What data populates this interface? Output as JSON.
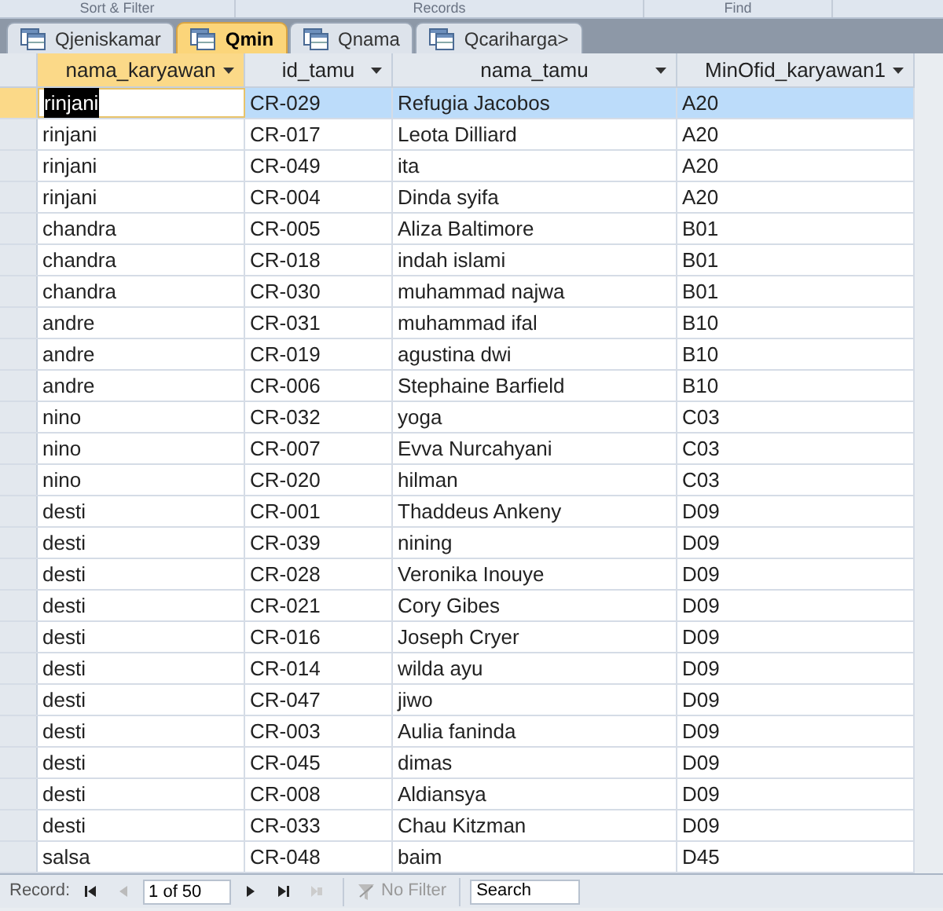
{
  "ribbon_groups": [
    "Sort & Filter",
    "Records",
    "Find"
  ],
  "tabs": [
    {
      "label": "Qjeniskamar",
      "selected": false
    },
    {
      "label": "Qmin",
      "selected": true
    },
    {
      "label": "Qnama",
      "selected": false
    },
    {
      "label": "Qcariharga>",
      "selected": false
    }
  ],
  "table": {
    "columns": [
      "nama_karyawan",
      "id_tamu",
      "nama_tamu",
      "MinOfid_karyawan1"
    ],
    "rows": [
      {
        "cells": [
          "rinjani",
          "CR-029",
          "Refugia Jacobos",
          "A20"
        ],
        "selected": true
      },
      {
        "cells": [
          "rinjani",
          "CR-017",
          "Leota Dilliard",
          "A20"
        ],
        "selected": false
      },
      {
        "cells": [
          "rinjani",
          "CR-049",
          "ita",
          "A20"
        ],
        "selected": false
      },
      {
        "cells": [
          "rinjani",
          "CR-004",
          "Dinda syifa",
          "A20"
        ],
        "selected": false
      },
      {
        "cells": [
          "chandra",
          "CR-005",
          "Aliza Baltimore",
          "B01"
        ],
        "selected": false
      },
      {
        "cells": [
          "chandra",
          "CR-018",
          "indah islami",
          "B01"
        ],
        "selected": false
      },
      {
        "cells": [
          "chandra",
          "CR-030",
          "muhammad najwa",
          "B01"
        ],
        "selected": false
      },
      {
        "cells": [
          "andre",
          "CR-031",
          "muhammad ifal",
          "B10"
        ],
        "selected": false
      },
      {
        "cells": [
          "andre",
          "CR-019",
          "agustina dwi",
          "B10"
        ],
        "selected": false
      },
      {
        "cells": [
          "andre",
          "CR-006",
          "Stephaine Barfield",
          "B10"
        ],
        "selected": false
      },
      {
        "cells": [
          "nino",
          "CR-032",
          "yoga",
          "C03"
        ],
        "selected": false
      },
      {
        "cells": [
          "nino",
          "CR-007",
          "Evva Nurcahyani",
          "C03"
        ],
        "selected": false
      },
      {
        "cells": [
          "nino",
          "CR-020",
          "hilman",
          "C03"
        ],
        "selected": false
      },
      {
        "cells": [
          "desti",
          "CR-001",
          "Thaddeus Ankeny",
          "D09"
        ],
        "selected": false
      },
      {
        "cells": [
          "desti",
          "CR-039",
          "nining",
          "D09"
        ],
        "selected": false
      },
      {
        "cells": [
          "desti",
          "CR-028",
          "Veronika Inouye",
          "D09"
        ],
        "selected": false
      },
      {
        "cells": [
          "desti",
          "CR-021",
          "Cory Gibes",
          "D09"
        ],
        "selected": false
      },
      {
        "cells": [
          "desti",
          "CR-016",
          "Joseph Cryer",
          "D09"
        ],
        "selected": false
      },
      {
        "cells": [
          "desti",
          "CR-014",
          "wilda ayu",
          "D09"
        ],
        "selected": false
      },
      {
        "cells": [
          "desti",
          "CR-047",
          "jiwo",
          "D09"
        ],
        "selected": false
      },
      {
        "cells": [
          "desti",
          "CR-003",
          "Aulia faninda",
          "D09"
        ],
        "selected": false
      },
      {
        "cells": [
          "desti",
          "CR-045",
          "dimas",
          "D09"
        ],
        "selected": false
      },
      {
        "cells": [
          "desti",
          "CR-008",
          "Aldiansya",
          "D09"
        ],
        "selected": false
      },
      {
        "cells": [
          "desti",
          "CR-033",
          "Chau Kitzman",
          "D09"
        ],
        "selected": false
      },
      {
        "cells": [
          "salsa",
          "CR-048",
          "baim",
          "D45"
        ],
        "selected": false
      }
    ]
  },
  "status_bar": {
    "label": "Record:",
    "position": "1 of 50",
    "filter": "No Filter",
    "search_placeholder": "Search"
  }
}
